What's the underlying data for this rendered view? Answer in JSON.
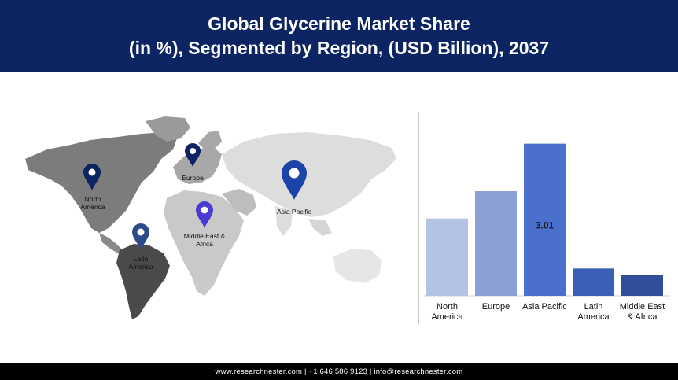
{
  "header": {
    "title_line1": "Global Glycerine Market Share",
    "title_line2": "(in %), Segmented by Region, (USD Billion), 2037"
  },
  "map": {
    "pins": [
      {
        "id": "north-america",
        "label_lines": [
          "North",
          "America"
        ],
        "color": "#0c2461"
      },
      {
        "id": "europe",
        "label_lines": [
          "Europe"
        ],
        "color": "#0c2461"
      },
      {
        "id": "asia-pacific",
        "label_lines": [
          "Asia Pacific"
        ],
        "color": "#1a44a8"
      },
      {
        "id": "middle-east-africa",
        "label_lines": [
          "Middle East &",
          "Africa"
        ],
        "color": "#4b3ad6"
      },
      {
        "id": "latin-america",
        "label_lines": [
          "Latin",
          "America"
        ],
        "color": "#2d4a8a"
      }
    ]
  },
  "chart_data": {
    "type": "bar",
    "categories": [
      [
        "North",
        "America"
      ],
      [
        "Europe"
      ],
      [
        "Asia Pacific"
      ],
      [
        "Latin",
        "America"
      ],
      [
        "Middle East",
        "& Africa"
      ]
    ],
    "values": [
      1.53,
      2.07,
      3.01,
      0.54,
      0.41
    ],
    "data_labels": [
      "",
      "",
      "3.01",
      "",
      ""
    ],
    "colors": [
      "#b4c2e3",
      "#8ca0d6",
      "#4a6fcc",
      "#3b5fb5",
      "#2f4f9a"
    ],
    "ylim": [
      0,
      3.3
    ]
  },
  "footer": {
    "text": "www.researchnester.com | +1 646 586 9123 | info@researchnester.com"
  }
}
